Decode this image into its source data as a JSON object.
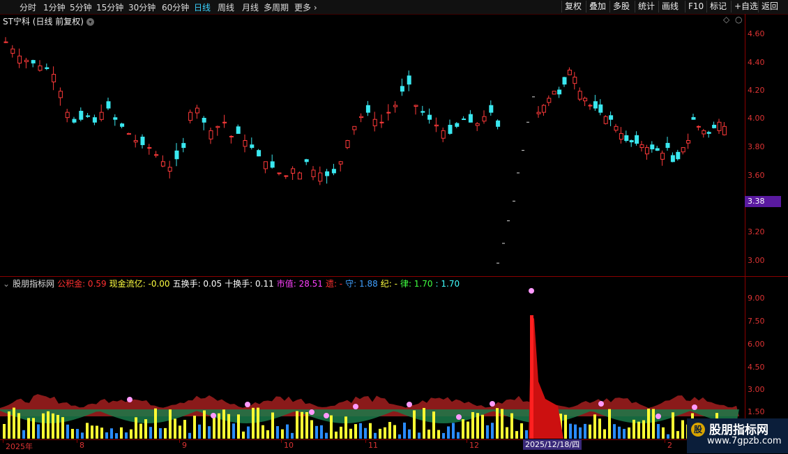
{
  "toolbar": {
    "periods": [
      "分时",
      "1分钟",
      "5分钟",
      "15分钟",
      "30分钟",
      "60分钟",
      "日线",
      "周线",
      "月线",
      "多周期",
      "更多"
    ],
    "active_period": "日线",
    "buttons": [
      "复权",
      "叠加",
      "多股",
      "统计",
      "画线",
      "F10",
      "标记",
      "+自选",
      "返回"
    ]
  },
  "main_chart": {
    "title": "ST宁科 (日线 前复权)",
    "price_axis": [
      "4.60",
      "4.40",
      "4.20",
      "4.00",
      "3.80",
      "3.60",
      "3.20",
      "3.00"
    ],
    "current_price_tag": "3.38"
  },
  "indicator": {
    "name": "股朋指标网",
    "items": [
      {
        "label": "公积金:",
        "value": "0.59",
        "color": "#ff3030"
      },
      {
        "label": "现金流亿:",
        "value": "-0.00",
        "color": "#ffff40"
      },
      {
        "label": "五换手:",
        "value": "0.05",
        "color": "#ffffff"
      },
      {
        "label": "十换手:",
        "value": "0.11",
        "color": "#ffffff"
      },
      {
        "label": "市值:",
        "value": "28.51",
        "color": "#ff40ff"
      },
      {
        "label": "遗:",
        "value": "-",
        "color": "#ff3030"
      },
      {
        "label": "守:",
        "value": "1.88",
        "color": "#40a0ff"
      },
      {
        "label": "纪:",
        "value": "-",
        "color": "#ffff40"
      },
      {
        "label": "律:",
        "value": "1.70",
        "color": "#40ff40"
      },
      {
        "label": ":",
        "value": "1.70",
        "color": "#40ffff"
      }
    ],
    "axis": [
      "9.00",
      "7.50",
      "6.00",
      "4.50",
      "3.00",
      "1.50"
    ]
  },
  "x_axis": {
    "labels": [
      "2025年",
      "8",
      "9",
      "10",
      "11",
      "12",
      "2"
    ],
    "cursor_date": "2025/12/18/四"
  },
  "watermark": {
    "line1": "股朋指标网",
    "line2": "www.7gpzb.com"
  },
  "colors": {
    "up": "#ff3a3a",
    "down": "#3ae8f0",
    "border": "#8b0000",
    "bar_yellow": "#ffff33",
    "bar_blue": "#2a8cff"
  }
}
